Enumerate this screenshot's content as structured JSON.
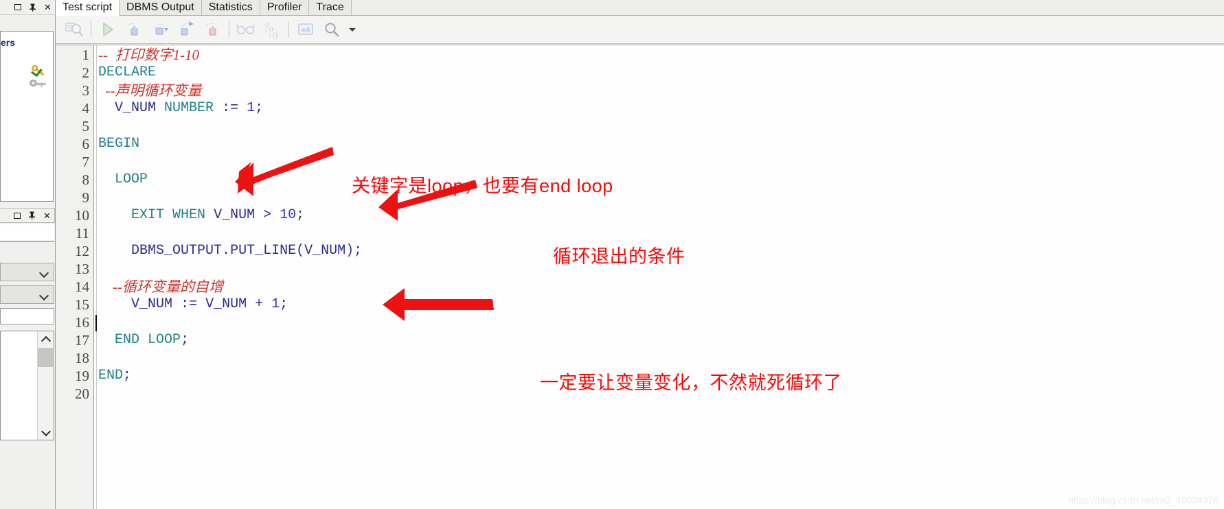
{
  "window": {
    "dock_controls": [
      {
        "name": "restore",
        "glyph": "□"
      },
      {
        "name": "pin",
        "glyph": "⊥"
      },
      {
        "name": "close",
        "glyph": "✕"
      }
    ]
  },
  "sidebar": {
    "users_label": "ers",
    "panel_icons": [
      "gold-key-icon",
      "grey-key-icon"
    ],
    "combo_1_value": "",
    "combo_2_value": "",
    "text_input_value": ""
  },
  "tabs": [
    {
      "label": "Test script",
      "active": true
    },
    {
      "label": "DBMS Output",
      "active": false
    },
    {
      "label": "Statistics",
      "active": false
    },
    {
      "label": "Profiler",
      "active": false
    },
    {
      "label": "Trace",
      "active": false
    }
  ],
  "toolbar": {
    "items": [
      {
        "name": "explain-plan-icon",
        "title": "Explain plan"
      },
      {
        "name": "separator-1",
        "title": ""
      },
      {
        "name": "execute-icon",
        "title": "Execute"
      },
      {
        "name": "step-into-icon",
        "title": "Step into"
      },
      {
        "name": "step-over-icon",
        "title": "Step over"
      },
      {
        "name": "step-out-icon",
        "title": "Step out"
      },
      {
        "name": "run-to-exception-icon",
        "title": "Run to exception"
      },
      {
        "name": "separator-2",
        "title": ""
      },
      {
        "name": "view-breakpoints-icon",
        "title": "Breakpoints"
      },
      {
        "name": "variables-icon",
        "title": "Variables"
      },
      {
        "name": "separator-3",
        "title": ""
      },
      {
        "name": "output-window-icon",
        "title": "Output"
      },
      {
        "name": "find-icon",
        "title": "Find"
      },
      {
        "name": "find-dropdown-icon",
        "title": "Find options"
      }
    ]
  },
  "editor": {
    "line_count": 20,
    "line_numbers": [
      "1",
      "2",
      "3",
      "4",
      "5",
      "6",
      "7",
      "8",
      "9",
      "10",
      "11",
      "12",
      "13",
      "14",
      "15",
      "16",
      "17",
      "18",
      "19",
      "20"
    ],
    "caret_line": 16,
    "lines": [
      {
        "n": 1,
        "type": "comment",
        "text": "--  打印数字1-10"
      },
      {
        "n": 2,
        "type": "code",
        "text": "DECLARE"
      },
      {
        "n": 3,
        "type": "comment",
        "text": "  --声明循环变量"
      },
      {
        "n": 4,
        "type": "code",
        "text": "  V_NUM NUMBER := 1;"
      },
      {
        "n": 5,
        "type": "blank",
        "text": ""
      },
      {
        "n": 6,
        "type": "code",
        "text": "BEGIN"
      },
      {
        "n": 7,
        "type": "blank",
        "text": ""
      },
      {
        "n": 8,
        "type": "code",
        "text": "  LOOP"
      },
      {
        "n": 9,
        "type": "blank",
        "text": ""
      },
      {
        "n": 10,
        "type": "code",
        "text": "    EXIT WHEN V_NUM > 10;"
      },
      {
        "n": 11,
        "type": "blank",
        "text": ""
      },
      {
        "n": 12,
        "type": "code",
        "text": "    DBMS_OUTPUT.PUT_LINE(V_NUM);"
      },
      {
        "n": 13,
        "type": "blank",
        "text": ""
      },
      {
        "n": 14,
        "type": "comment",
        "text": "    --循环变量的自增"
      },
      {
        "n": 15,
        "type": "code",
        "text": "    V_NUM := V_NUM + 1;"
      },
      {
        "n": 16,
        "type": "blank",
        "text": ""
      },
      {
        "n": 17,
        "type": "code",
        "text": "  END LOOP;"
      },
      {
        "n": 18,
        "type": "blank",
        "text": ""
      },
      {
        "n": 19,
        "type": "code",
        "text": "END;"
      },
      {
        "n": 20,
        "type": "blank",
        "text": ""
      }
    ]
  },
  "annotations": [
    {
      "id": 1,
      "text": "关键字是loop，也要有end loop",
      "color": "#fb0606",
      "points_to_line": 8
    },
    {
      "id": 2,
      "text": "循环退出的条件",
      "color": "#fb0606",
      "points_to_line": 10
    },
    {
      "id": 3,
      "text": "一定要让变量变化，不然就死循环了",
      "color": "#fb0606",
      "points_to_line": 15
    }
  ],
  "watermark": {
    "text": "https://blog.csdn.net/m0_48038376"
  },
  "colors": {
    "keyword": "#1f7f8c",
    "identifier": "#2b2b8f",
    "number": "#3333cc",
    "comment": "#d0342c",
    "annotation": "#fb0606",
    "editor_bg": "#fefefe",
    "gutter_bg": "#f1f1ef",
    "toolbar_bg": "#f4f4f2"
  }
}
